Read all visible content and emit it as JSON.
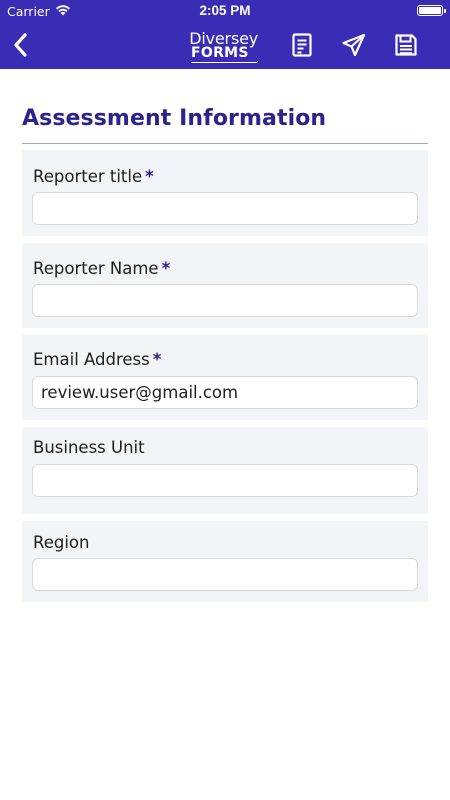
{
  "status_bar": {
    "carrier": "Carrier",
    "time": "2:05 PM"
  },
  "nav": {
    "logo_line1": "Diversey",
    "logo_line2": "FORMS",
    "icons": [
      "back-chevron-icon",
      "document-icon",
      "send-icon",
      "save-icon"
    ]
  },
  "colors": {
    "brand": "#3a2cb4",
    "title": "#2d238f",
    "card_bg": "#f2f4f7"
  },
  "section": {
    "title": "Assessment Information"
  },
  "fields": [
    {
      "label": "Reporter title",
      "required": "*",
      "value": ""
    },
    {
      "label": "Reporter Name",
      "required": "*",
      "value": ""
    },
    {
      "label": "Email Address",
      "required": "*",
      "value": "review.user@gmail.com"
    },
    {
      "label": "Business Unit",
      "required": "",
      "value": ""
    },
    {
      "label": "Region",
      "required": "",
      "value": ""
    }
  ]
}
